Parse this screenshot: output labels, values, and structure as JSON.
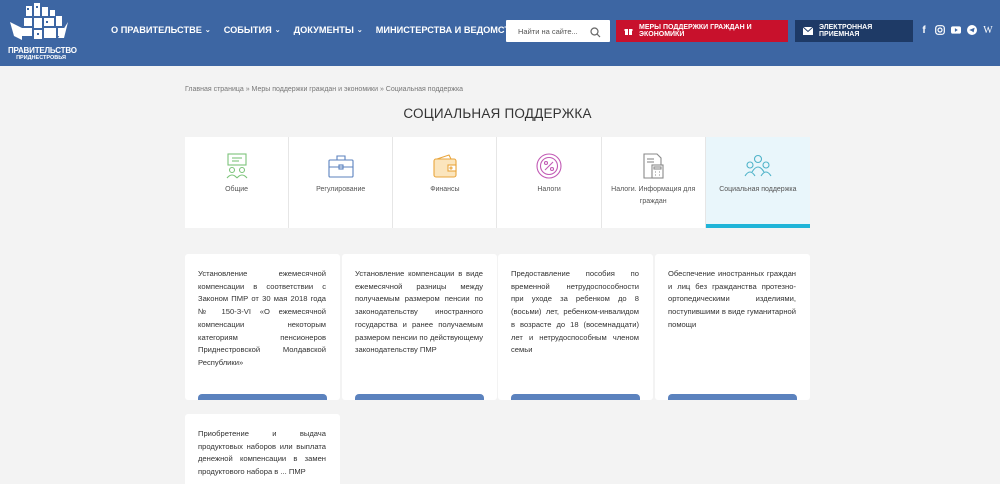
{
  "header": {
    "logo": {
      "line1": "ПРАВИТЕЛЬСТВО",
      "line2": "ПРИДНЕСТРОВЬЯ"
    },
    "nav": [
      {
        "label": "О ПРАВИТЕЛЬСТВЕ",
        "has_dropdown": true
      },
      {
        "label": "СОБЫТИЯ",
        "has_dropdown": true
      },
      {
        "label": "ДОКУМЕНТЫ",
        "has_dropdown": true
      },
      {
        "label": "МИНИСТЕРСТВА И ВЕДОМСТВА",
        "has_dropdown": false
      }
    ],
    "search": {
      "placeholder": "Найти на сайте..."
    },
    "support_button": "МЕРЫ ПОДДЕРЖКИ ГРАЖДАН И ЭКОНОМИКИ",
    "reception_button": "ЭЛЕКТРОННАЯ ПРИЕМНАЯ",
    "socials": [
      "facebook-icon",
      "instagram-icon",
      "youtube-icon",
      "telegram-icon",
      "vk-icon"
    ]
  },
  "breadcrumb": "Главная страница » Меры поддержки граждан и экономики » Социальная поддержка",
  "page_title": "СОЦИАЛЬНАЯ ПОДДЕРЖКА",
  "tabs": [
    {
      "label": "Общие",
      "icon": "people-board-icon",
      "color": "#7cc47a"
    },
    {
      "label": "Регулирование",
      "icon": "briefcase-icon",
      "color": "#5b82be"
    },
    {
      "label": "Финансы",
      "icon": "wallet-icon",
      "color": "#e9a53c"
    },
    {
      "label": "Налоги",
      "icon": "percent-icon",
      "color": "#c25ab5"
    },
    {
      "label": "Налоги. Информация для граждан",
      "icon": "calculator-doc-icon",
      "color": "#8a8a8a"
    },
    {
      "label": "Социальная поддержка",
      "icon": "group-icon",
      "color": "#4fb3c9",
      "active": true
    }
  ],
  "cards": [
    {
      "text": "Установление ежемесячной компенсации в соответствии с Законом ПМР от 30 мая 2018 года № 150-З-VI «О ежемесячной компенсации некоторым категориям пенсионеров Приднестровской Молдавской Республики»"
    },
    {
      "text": "Установление компенсации в виде ежемесячной разницы между получаемым размером пенсии по законодательству иностранного государства и ранее получаемым размером пенсии по действующему законодательству ПМР"
    },
    {
      "text": "Предоставление пособия по временной нетрудоспособности при уходе за ребенком до 8 (восьми) лет, ребенком-инвалидом в возрасте до 18 (восемнадцати) лет и нетрудоспособным членом семьи"
    },
    {
      "text": "Обеспечение иностранных граждан и лиц без гражданства протезно-ортопедическими изделиями, поступившими в виде гуманитарной помощи"
    },
    {
      "text": "Приобретение и выдача продуктовых наборов или выплата денежной компенсации в замен продуктового набора в ... ПМР"
    }
  ]
}
